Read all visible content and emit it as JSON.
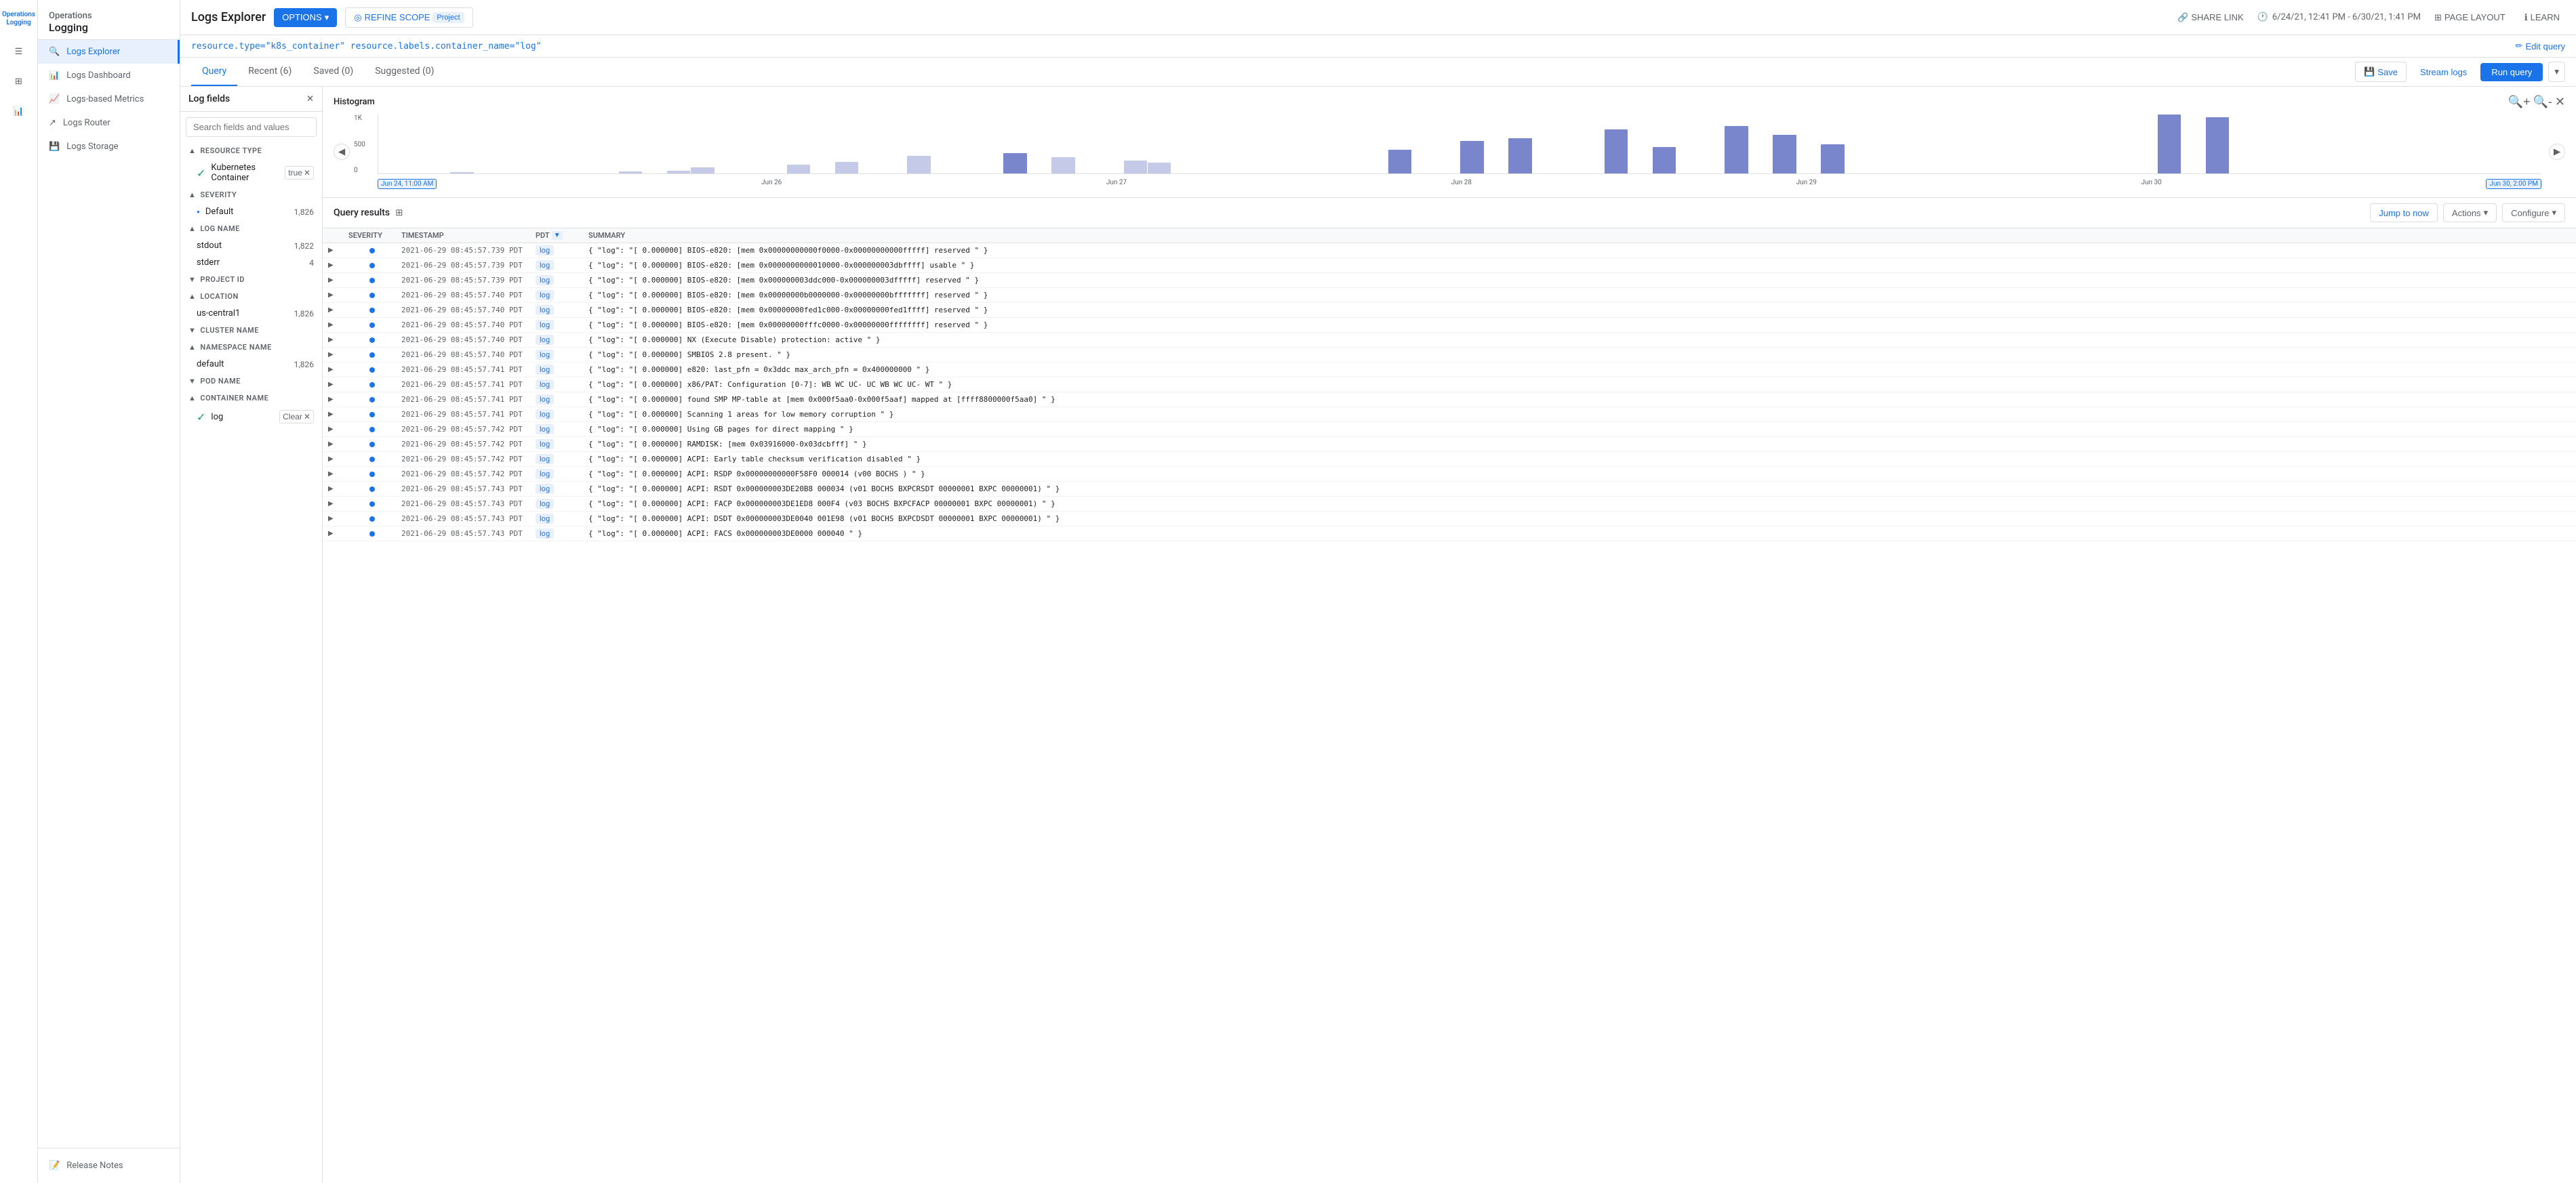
{
  "app": {
    "title": "Operations Logging",
    "title_line1": "Operations",
    "title_line2": "Logging"
  },
  "sidebar": {
    "items": [
      {
        "id": "menu",
        "icon": "☰",
        "label": "Menu"
      },
      {
        "id": "grid",
        "icon": "⊞",
        "label": "Dashboard"
      },
      {
        "id": "chart",
        "icon": "📊",
        "label": "Metrics"
      }
    ]
  },
  "left_nav": {
    "items": [
      {
        "id": "logs-explorer",
        "label": "Logs Explorer",
        "active": true
      },
      {
        "id": "logs-dashboard",
        "label": "Logs Dashboard",
        "active": false
      },
      {
        "id": "logs-metrics",
        "label": "Logs-based Metrics",
        "active": false
      },
      {
        "id": "logs-router",
        "label": "Logs Router",
        "active": false
      },
      {
        "id": "logs-storage",
        "label": "Logs Storage",
        "active": false
      }
    ],
    "bottom": [
      {
        "id": "release-notes",
        "label": "Release Notes"
      }
    ]
  },
  "header": {
    "page_title": "Logs Explorer",
    "btn_options": "OPTIONS",
    "btn_refine": "REFINE SCOPE",
    "badge_project": "Project",
    "btn_share": "SHARE LINK",
    "date_range": "6/24/21, 12:41 PM - 6/30/21, 1:41 PM",
    "btn_page_layout": "PAGE LAYOUT",
    "btn_learn": "LEARN"
  },
  "query": {
    "text": "resource.type=\"k8s_container\" resource.labels.container_name=\"log\"",
    "btn_edit": "Edit query"
  },
  "tabs": {
    "items": [
      {
        "id": "query",
        "label": "Query",
        "active": true
      },
      {
        "id": "recent",
        "label": "Recent (6)",
        "active": false
      },
      {
        "id": "saved",
        "label": "Saved (0)",
        "active": false
      },
      {
        "id": "suggested",
        "label": "Suggested (0)",
        "active": false
      }
    ],
    "btn_save": "Save",
    "btn_stream": "Stream logs",
    "btn_run": "Run query"
  },
  "log_fields": {
    "title": "Log fields",
    "search_placeholder": "Search fields and values",
    "sections": [
      {
        "id": "resource-type",
        "label": "RESOURCE TYPE",
        "expanded": true,
        "items": [
          {
            "label": "Kubernetes Container",
            "checked": true,
            "clear": true
          }
        ]
      },
      {
        "id": "severity",
        "label": "SEVERITY",
        "expanded": true,
        "items": [
          {
            "label": "Default",
            "count": "1,826",
            "dot": true
          }
        ]
      },
      {
        "id": "log-name",
        "label": "LOG NAME",
        "expanded": true,
        "items": [
          {
            "label": "stdout",
            "count": "1,822"
          },
          {
            "label": "stderr",
            "count": "4"
          }
        ]
      },
      {
        "id": "project-id",
        "label": "PROJECT ID",
        "expanded": false
      },
      {
        "id": "location",
        "label": "LOCATION",
        "expanded": true,
        "items": [
          {
            "label": "us-central1",
            "count": "1,826"
          }
        ]
      },
      {
        "id": "cluster-name",
        "label": "CLUSTER NAME",
        "expanded": false
      },
      {
        "id": "namespace-name",
        "label": "NAMESPACE NAME",
        "expanded": true,
        "items": [
          {
            "label": "default",
            "count": "1,826"
          }
        ]
      },
      {
        "id": "pod-name",
        "label": "POD NAME",
        "expanded": false
      },
      {
        "id": "container-name",
        "label": "CONTAINER NAME",
        "expanded": true,
        "items": [
          {
            "label": "log",
            "checked": true,
            "clear": true
          }
        ]
      }
    ]
  },
  "histogram": {
    "title": "Histogram",
    "y_labels": [
      "1K",
      "500",
      "0"
    ],
    "dates": [
      "Jun 24, 11:00 AM",
      "Jun 26",
      "Jun 27",
      "Jun 28",
      "Jun 29",
      "Jun 30, 2:00 PM"
    ],
    "start_date": "Jun 24, 11:00 AM",
    "end_date": "Jun 30, 2:00 PM"
  },
  "query_results": {
    "title": "Query results",
    "btn_jump": "Jump to now",
    "btn_actions": "Actions",
    "btn_configure": "Configure",
    "columns": [
      "",
      "SEVERITY",
      "TIMESTAMP",
      "PDT",
      "SUMMARY"
    ],
    "rows": [
      {
        "severity": "info",
        "timestamp": "2021-06-29 08:45:57.739 PDT",
        "badge": "log",
        "summary": "{ \"log\": \"[ 0.000000] BIOS-e820: [mem 0x00000000000f0000-0x00000000000fffff] reserved \" }"
      },
      {
        "severity": "info",
        "timestamp": "2021-06-29 08:45:57.739 PDT",
        "badge": "log",
        "summary": "{ \"log\": \"[ 0.000000] BIOS-e820: [mem 0x0000000000010000-0x000000003dbffff] usable \" }"
      },
      {
        "severity": "info",
        "timestamp": "2021-06-29 08:45:57.739 PDT",
        "badge": "log",
        "summary": "{ \"log\": \"[ 0.000000] BIOS-e820: [mem 0x000000003ddc000-0x000000003dfffff] reserved \" }"
      },
      {
        "severity": "info",
        "timestamp": "2021-06-29 08:45:57.740 PDT",
        "badge": "log",
        "summary": "{ \"log\": \"[ 0.000000] BIOS-e820: [mem 0x00000000b0000000-0x00000000bfffffff] reserved \" }"
      },
      {
        "severity": "info",
        "timestamp": "2021-06-29 08:45:57.740 PDT",
        "badge": "log",
        "summary": "{ \"log\": \"[ 0.000000] BIOS-e820: [mem 0x00000000fed1c000-0x00000000fed1ffff] reserved \" }"
      },
      {
        "severity": "info",
        "timestamp": "2021-06-29 08:45:57.740 PDT",
        "badge": "log",
        "summary": "{ \"log\": \"[ 0.000000] BIOS-e820: [mem 0x00000000fffc0000-0x00000000ffffffff] reserved \" }"
      },
      {
        "severity": "info",
        "timestamp": "2021-06-29 08:45:57.740 PDT",
        "badge": "log",
        "summary": "{ \"log\": \"[ 0.000000] NX (Execute Disable) protection: active \" }"
      },
      {
        "severity": "info",
        "timestamp": "2021-06-29 08:45:57.740 PDT",
        "badge": "log",
        "summary": "{ \"log\": \"[ 0.000000] SMBIOS 2.8 present. \" }"
      },
      {
        "severity": "info",
        "timestamp": "2021-06-29 08:45:57.741 PDT",
        "badge": "log",
        "summary": "{ \"log\": \"[ 0.000000] e820: last_pfn = 0x3ddc max_arch_pfn = 0x400000000 \" }"
      },
      {
        "severity": "info",
        "timestamp": "2021-06-29 08:45:57.741 PDT",
        "badge": "log",
        "summary": "{ \"log\": \"[ 0.000000] x86/PAT: Configuration [0-7]: WB WC UC- UC WB WC UC- WT \" }"
      },
      {
        "severity": "info",
        "timestamp": "2021-06-29 08:45:57.741 PDT",
        "badge": "log",
        "summary": "{ \"log\": \"[ 0.000000] found SMP MP-table at [mem 0x000f5aa0-0x000f5aaf] mapped at [ffff8800000f5aa0] \" }"
      },
      {
        "severity": "info",
        "timestamp": "2021-06-29 08:45:57.741 PDT",
        "badge": "log",
        "summary": "{ \"log\": \"[ 0.000000] Scanning 1 areas for low memory corruption \" }"
      },
      {
        "severity": "info",
        "timestamp": "2021-06-29 08:45:57.742 PDT",
        "badge": "log",
        "summary": "{ \"log\": \"[ 0.000000] Using GB pages for direct mapping \" }"
      },
      {
        "severity": "info",
        "timestamp": "2021-06-29 08:45:57.742 PDT",
        "badge": "log",
        "summary": "{ \"log\": \"[ 0.000000] RAMDISK: [mem 0x03916000-0x03dcbfff] \" }"
      },
      {
        "severity": "info",
        "timestamp": "2021-06-29 08:45:57.742 PDT",
        "badge": "log",
        "summary": "{ \"log\": \"[ 0.000000] ACPI: Early table checksum verification disabled \" }"
      },
      {
        "severity": "info",
        "timestamp": "2021-06-29 08:45:57.742 PDT",
        "badge": "log",
        "summary": "{ \"log\": \"[ 0.000000] ACPI: RSDP 0x00000000000F58F0 000014 (v00 BOCHS ) \" }"
      },
      {
        "severity": "info",
        "timestamp": "2021-06-29 08:45:57.743 PDT",
        "badge": "log",
        "summary": "{ \"log\": \"[ 0.000000] ACPI: RSDT 0x000000003DE20B8 000034 (v01 BOCHS BXPCRSDT 00000001 BXPC 00000001) \" }"
      },
      {
        "severity": "info",
        "timestamp": "2021-06-29 08:45:57.743 PDT",
        "badge": "log",
        "summary": "{ \"log\": \"[ 0.000000] ACPI: FACP 0x000000003DE1ED8 000F4 (v03 BOCHS BXPCFACP 00000001 BXPC 00000001) \" }"
      },
      {
        "severity": "info",
        "timestamp": "2021-06-29 08:45:57.743 PDT",
        "badge": "log",
        "summary": "{ \"log\": \"[ 0.000000] ACPI: DSDT 0x000000003DE0040 001E98 (v01 BOCHS BXPCDSDT 00000001 BXPC 00000001) \" }"
      },
      {
        "severity": "info",
        "timestamp": "2021-06-29 08:45:57.743 PDT",
        "badge": "log",
        "summary": "{ \"log\": \"[ 0.000000] ACPI: FACS 0x000000003DE0000 000040 \" }"
      }
    ]
  }
}
